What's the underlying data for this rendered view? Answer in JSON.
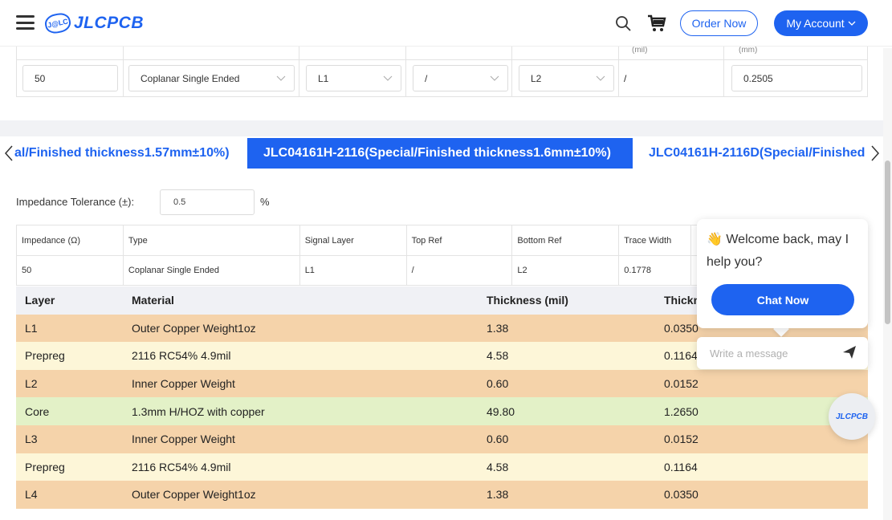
{
  "header": {
    "logo_mark": "J@LC",
    "logo_text": "JLCPCB",
    "order_now": "Order Now",
    "my_account": "My Account"
  },
  "top_table": {
    "sub_headers": [
      "(mil)",
      "(mm)"
    ],
    "impedance": "50",
    "type": "Coplanar Single Ended",
    "signal_layer": "L1",
    "top_ref": "/",
    "bottom_ref": "L2",
    "trace_width_mil": "/",
    "trace_width_mm": "0.2505"
  },
  "tabs": [
    {
      "label": "al/Finished thickness1.57mm±10%)",
      "active": false
    },
    {
      "label": "JLC04161H-2116(Special/Finished thickness1.6mm±10%)",
      "active": true
    },
    {
      "label": "JLC04161H-2116D(Special/Finished",
      "active": false
    }
  ],
  "tolerance": {
    "label": "Impedance Tolerance (±):",
    "value": "0.5",
    "unit": "%"
  },
  "impedance_table": {
    "headers": [
      "Impedance (Ω)",
      "Type",
      "Signal Layer",
      "Top Ref",
      "Bottom Ref",
      "Trace Width",
      ""
    ],
    "row": [
      "50",
      "Coplanar Single Ended",
      "L1",
      "/",
      "L2",
      "0.1778",
      ""
    ]
  },
  "stackup": {
    "headers": [
      "Layer",
      "Material",
      "Thickness (mil)",
      "Thickn"
    ],
    "rows": [
      {
        "layer": "L1",
        "material": "Outer Copper Weight1oz",
        "mil": "1.38",
        "mm": "0.0350"
      },
      {
        "layer": "Prepreg",
        "material": "2116 RC54% 4.9mil",
        "mil": "4.58",
        "mm": "0.1164"
      },
      {
        "layer": "L2",
        "material": "Inner Copper Weight",
        "mil": "0.60",
        "mm": "0.0152"
      },
      {
        "layer": "Core",
        "material": "1.3mm H/HOZ with copper",
        "mil": "49.80",
        "mm": "1.2650"
      },
      {
        "layer": "L3",
        "material": "Inner Copper Weight",
        "mil": "0.60",
        "mm": "0.0152"
      },
      {
        "layer": "Prepreg",
        "material": "2116 RC54% 4.9mil",
        "mil": "4.58",
        "mm": "0.1164"
      },
      {
        "layer": "L4",
        "material": "Outer Copper Weight1oz",
        "mil": "1.38",
        "mm": "0.0350"
      }
    ]
  },
  "chat": {
    "message": "👋 Welcome back, may I help you?",
    "button": "Chat Now",
    "input_placeholder": "Write a message",
    "bubble_label": "JLCPCB"
  },
  "colors": {
    "accent": "#1e63f0",
    "copper_row": "#f5d3aa",
    "prepreg_row": "#fdf6d8",
    "core_row": "#e3f1c7"
  }
}
